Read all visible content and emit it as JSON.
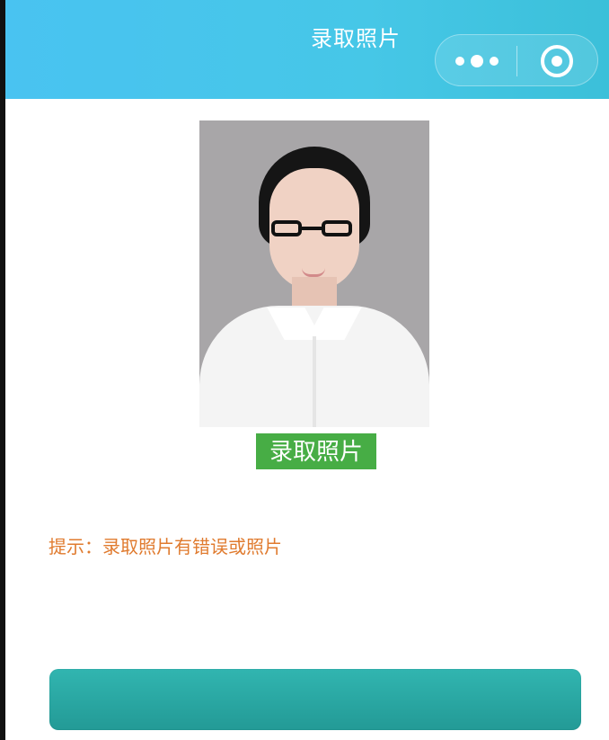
{
  "header": {
    "title": "录取照片",
    "background_color": "#46c7e7",
    "more_icon": "more-dots-icon",
    "close_icon": "target-icon"
  },
  "photo": {
    "description": ""
  },
  "actions": {
    "capture_label": "录取照片",
    "submit_label": ""
  },
  "tip": {
    "text": "提示：录取照片有错误或照片"
  },
  "colors": {
    "accent_green": "#47ad45",
    "tip_orange": "#e07b2f",
    "bottom_teal": "#239a96"
  }
}
